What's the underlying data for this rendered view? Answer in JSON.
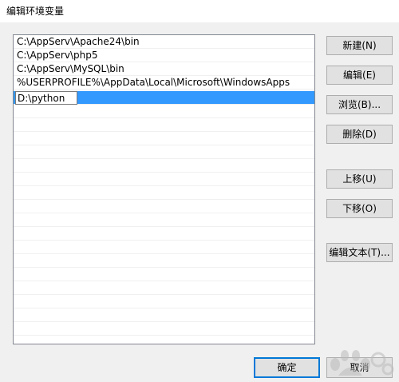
{
  "window": {
    "title": "编辑环境变量"
  },
  "entries": [
    "C:\\AppServ\\Apache24\\bin",
    "C:\\AppServ\\php5",
    "C:\\AppServ\\MySQL\\bin",
    "%USERPROFILE%\\AppData\\Local\\Microsoft\\WindowsApps"
  ],
  "editing_value": "D:\\python",
  "buttons": {
    "new": "新建(N)",
    "edit": "编辑(E)",
    "browse": "浏览(B)...",
    "delete": "删除(D)",
    "move_up": "上移(U)",
    "move_down": "下移(O)",
    "edit_text": "编辑文本(T)...",
    "ok": "确定",
    "cancel": "取消"
  },
  "colors": {
    "selection": "#3399ff",
    "default_button_border": "#0078d7"
  },
  "watermark_icon": "baidu-paw-icon"
}
